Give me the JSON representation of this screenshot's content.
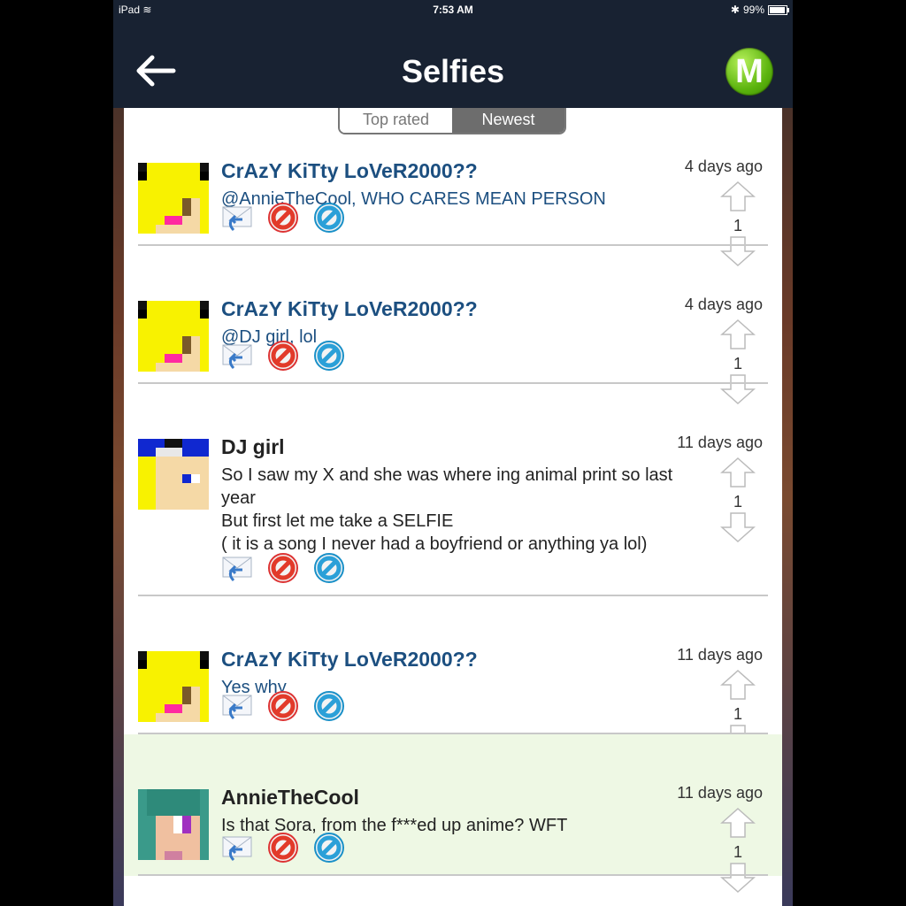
{
  "status": {
    "device": "iPad",
    "time": "7:53 AM",
    "battery": "99%"
  },
  "nav": {
    "title": "Selfies",
    "logo_letter": "M"
  },
  "tabs": {
    "top_rated": "Top rated",
    "newest": "Newest"
  },
  "posts": [
    {
      "author": "CrAzY KiTty LoVeR2000??",
      "author_color": "#1c4f80",
      "message": "@AnnieTheCool, WHO CARES MEAN PERSON",
      "message_color": "#1c4f80",
      "time": "4 days ago",
      "score": "1",
      "avatar": "kitty"
    },
    {
      "author": "CrAzY KiTty LoVeR2000??",
      "author_color": "#1c4f80",
      "message": "@DJ girl, lol",
      "message_color": "#1c4f80",
      "time": "4 days ago",
      "score": "1",
      "avatar": "kitty"
    },
    {
      "author": "DJ girl",
      "author_color": "#222222",
      "message": "So I saw my X and she was where ing animal print so last year\nBut first let me take a SELFIE\n( it is a song I never had a boyfriend or anything ya lol)",
      "message_color": "#222222",
      "time": "11 days ago",
      "score": "1",
      "avatar": "djgirl"
    },
    {
      "author": "CrAzY KiTty LoVeR2000??",
      "author_color": "#1c4f80",
      "message": "Yes why",
      "message_color": "#1c4f80",
      "time": "11 days ago",
      "score": "1",
      "avatar": "kitty"
    },
    {
      "author": "AnnieTheCool",
      "author_color": "#222222",
      "message": "Is that Sora, from the f***ed up anime? WFT",
      "message_color": "#222222",
      "time": "11 days ago",
      "score": "1",
      "avatar": "annie",
      "highlight": "#eef8e4"
    }
  ]
}
